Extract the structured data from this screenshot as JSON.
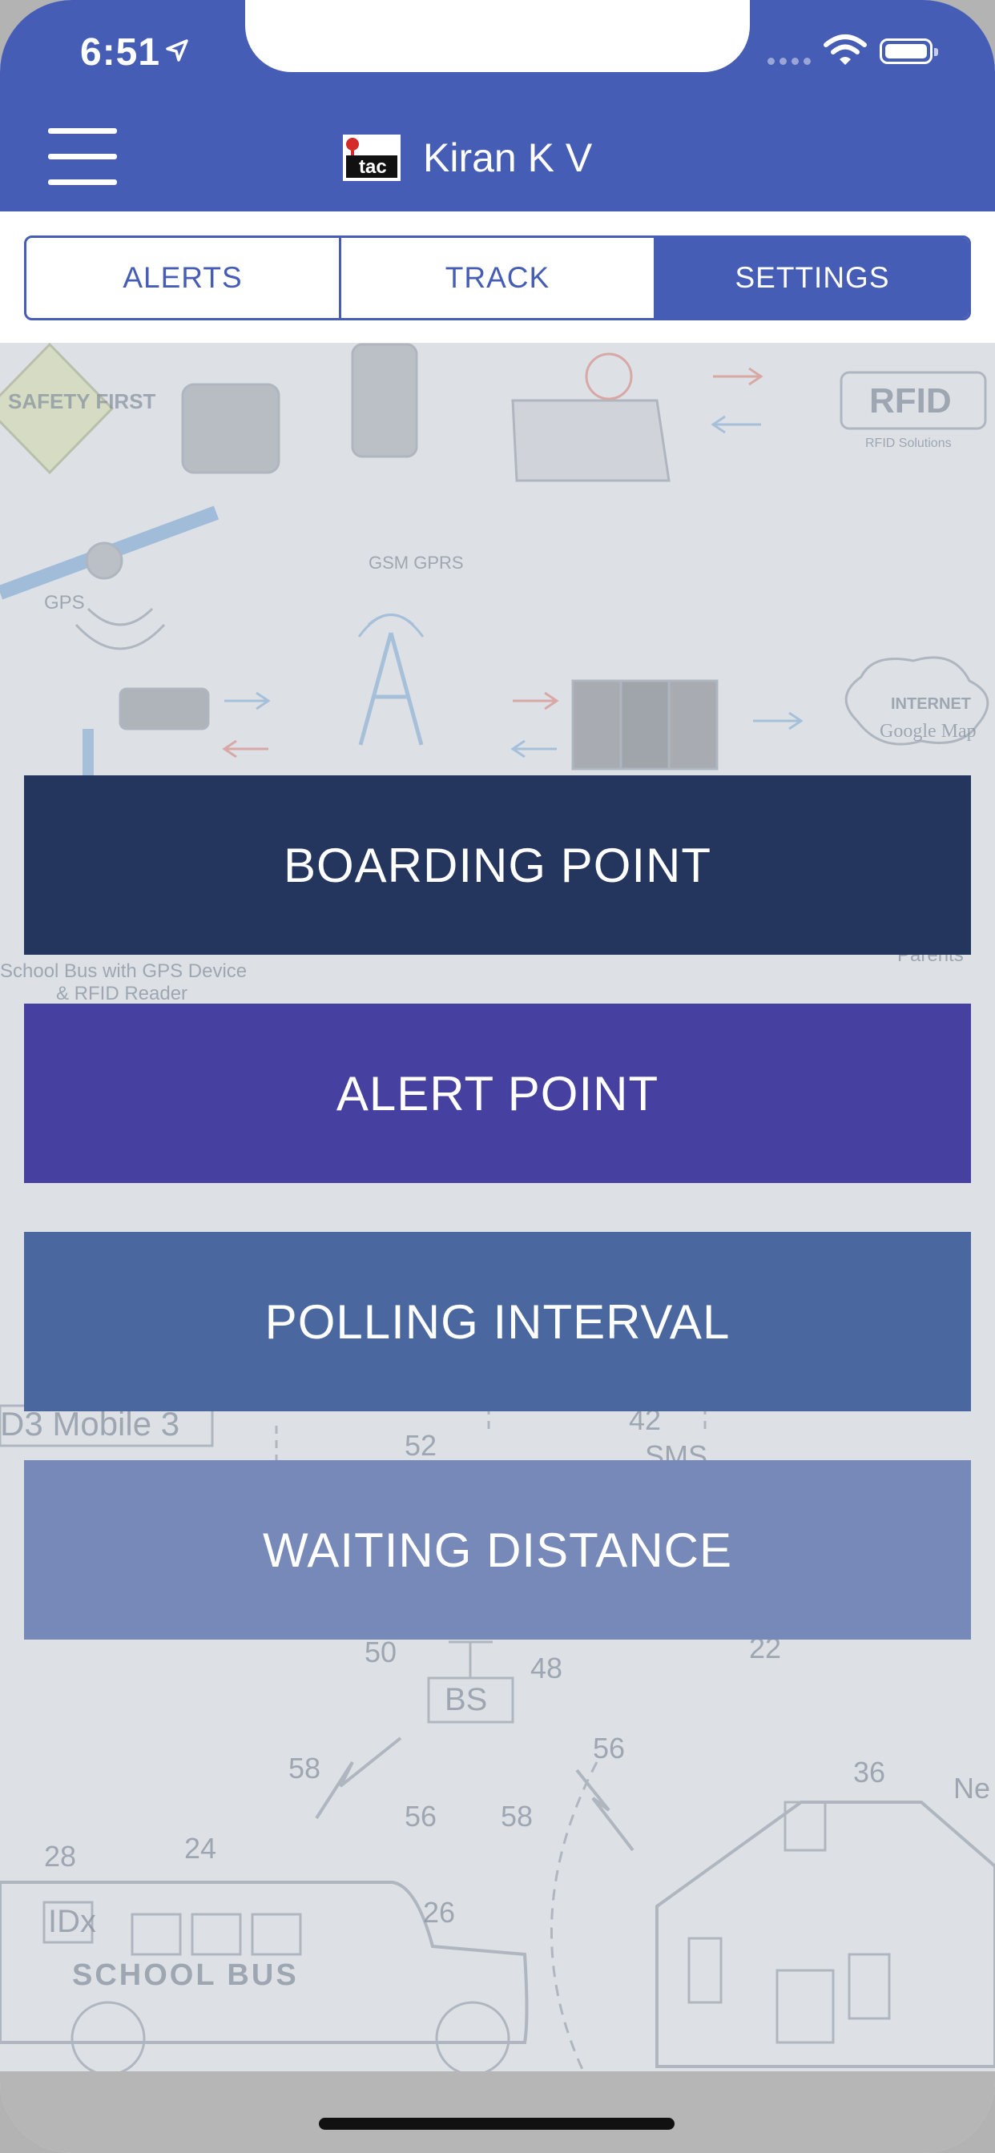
{
  "status_bar": {
    "time": "6:51"
  },
  "nav": {
    "title": "Kiran K V",
    "logo_text": "itac"
  },
  "tabs": [
    {
      "label": "ALERTS",
      "active": false
    },
    {
      "label": "TRACK",
      "active": false
    },
    {
      "label": "SETTINGS",
      "active": true
    }
  ],
  "actions": [
    {
      "label": "BOARDING POINT",
      "color": "#24355e"
    },
    {
      "label": "ALERT POINT",
      "color": "#4641a0"
    },
    {
      "label": "POLLING INTERVAL",
      "color": "#4b67a0"
    },
    {
      "label": "WAITING DISTANCE",
      "color": "#7689b9"
    }
  ],
  "background_labels": {
    "safety": "SAFETY FIRST",
    "gps": "GPS",
    "gsm": "GSM GPRS",
    "rfid": "RFID",
    "rfid_sub": "RFID Solutions",
    "internet": "INTERNET",
    "google_map": "Google Map",
    "school_bus_caption_1": "School Bus with GPS Device",
    "school_bus_caption_2": "& RFID Reader",
    "parents": "Parents",
    "mobile": "D3 Mobile 3",
    "sms": "SMS",
    "bs": "BS",
    "school_bus": "SCHOOL BUS",
    "idx": "IDx",
    "ref_52": "52",
    "ref_42": "42",
    "ref_50": "50",
    "ref_48": "48",
    "ref_22": "22",
    "ref_58a": "58",
    "ref_56a": "56",
    "ref_58b": "58",
    "ref_56b": "56",
    "ref_36": "36",
    "ref_28": "28",
    "ref_24": "24",
    "ref_26": "26",
    "ref_ne": "Ne"
  },
  "colors": {
    "header": "#465db5",
    "tab_border": "#465db5",
    "background": "#dde1e6"
  }
}
